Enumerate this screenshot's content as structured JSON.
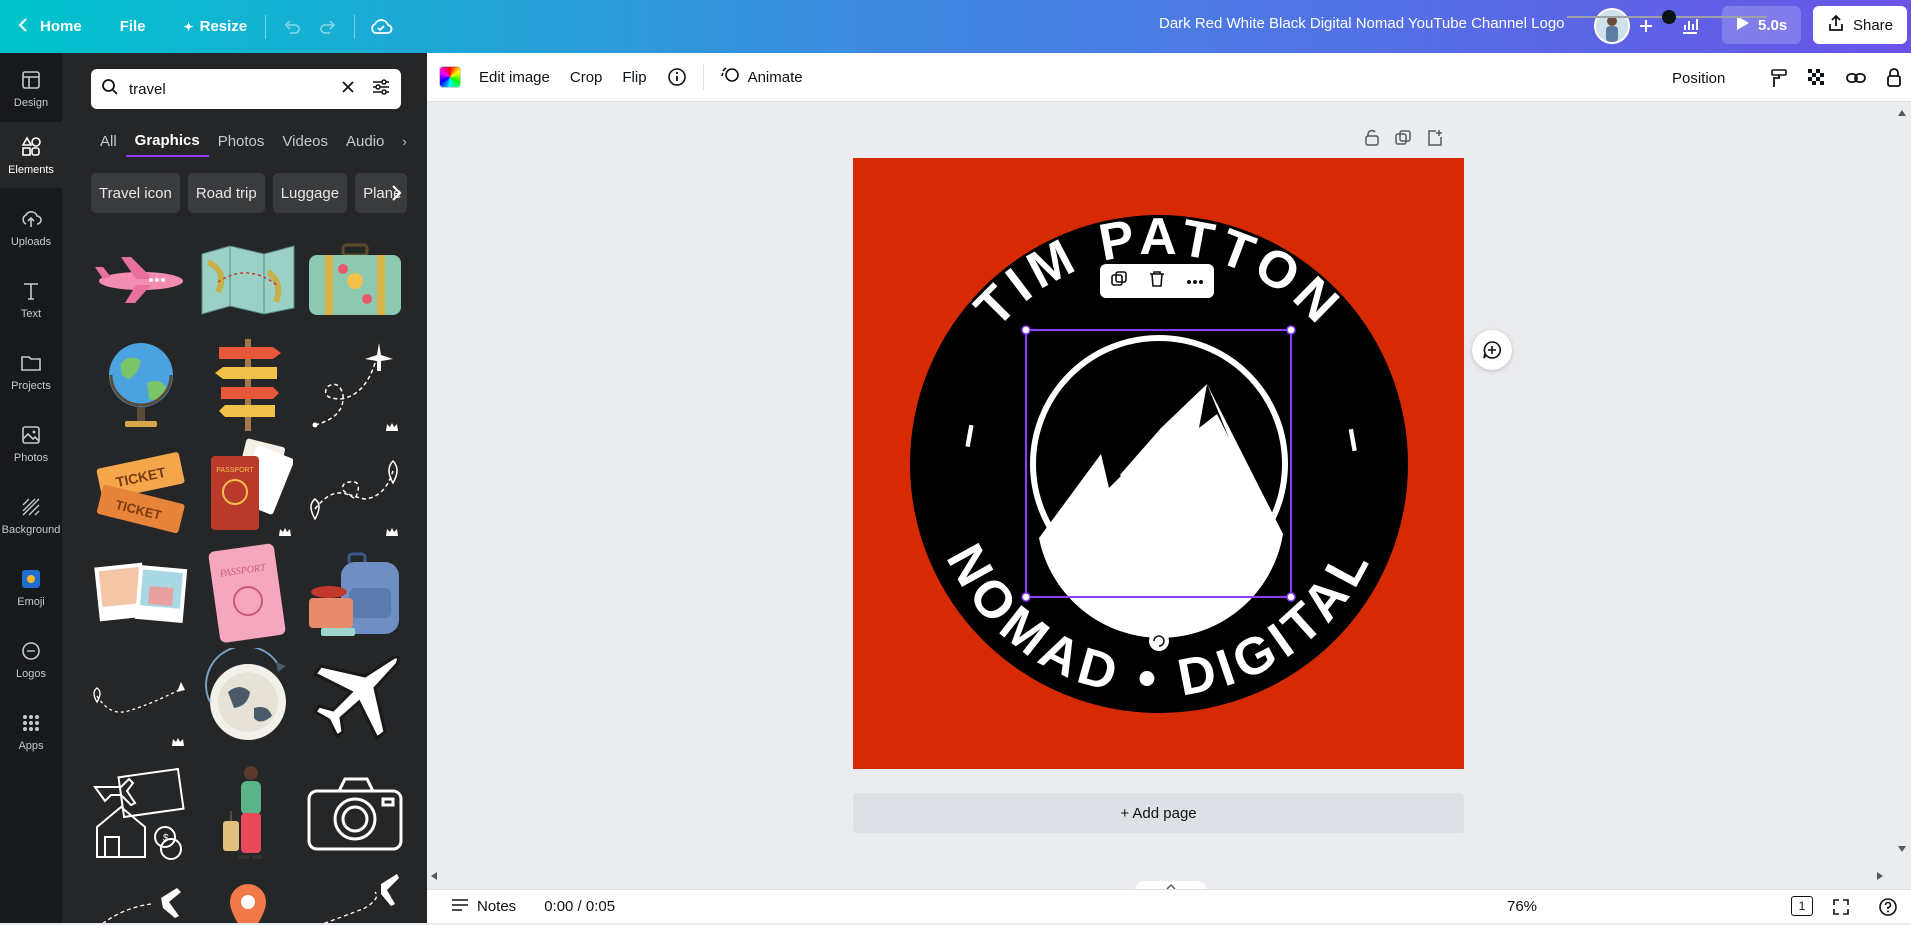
{
  "topbar": {
    "home": "Home",
    "file": "File",
    "resize": "Resize",
    "doc_title": "Dark Red White Black Digital Nomad  YouTube Channel Logo",
    "play_duration": "5.0s",
    "share": "Share"
  },
  "rail": [
    {
      "label": "Design",
      "icon": "design-icon"
    },
    {
      "label": "Elements",
      "icon": "elements-icon"
    },
    {
      "label": "Uploads",
      "icon": "upload-icon"
    },
    {
      "label": "Text",
      "icon": "text-icon"
    },
    {
      "label": "Projects",
      "icon": "folder-icon"
    },
    {
      "label": "Photos",
      "icon": "photo-icon"
    },
    {
      "label": "Background",
      "icon": "background-icon"
    },
    {
      "label": "Emoji",
      "icon": "emoji-icon"
    },
    {
      "label": "Logos",
      "icon": "logo-icon"
    },
    {
      "label": "Apps",
      "icon": "apps-icon"
    }
  ],
  "panel": {
    "search_value": "travel",
    "tabs": [
      "All",
      "Graphics",
      "Photos",
      "Videos",
      "Audio"
    ],
    "active_tab": "Graphics",
    "chips": [
      "Travel icon",
      "Road trip",
      "Luggage",
      "Plane"
    ]
  },
  "editor_toolbar": {
    "edit_image": "Edit image",
    "crop": "Crop",
    "flip": "Flip",
    "animate": "Animate",
    "position": "Position"
  },
  "design": {
    "background_color": "#d62a04",
    "circle_text": [
      "TIM",
      "PATTON",
      "DIGITAL",
      "NOMAD"
    ]
  },
  "canvas": {
    "add_page": "+ Add page"
  },
  "bottombar": {
    "notes": "Notes",
    "time": "0:00 / 0:05",
    "zoom": "76%",
    "page_count": "1"
  }
}
